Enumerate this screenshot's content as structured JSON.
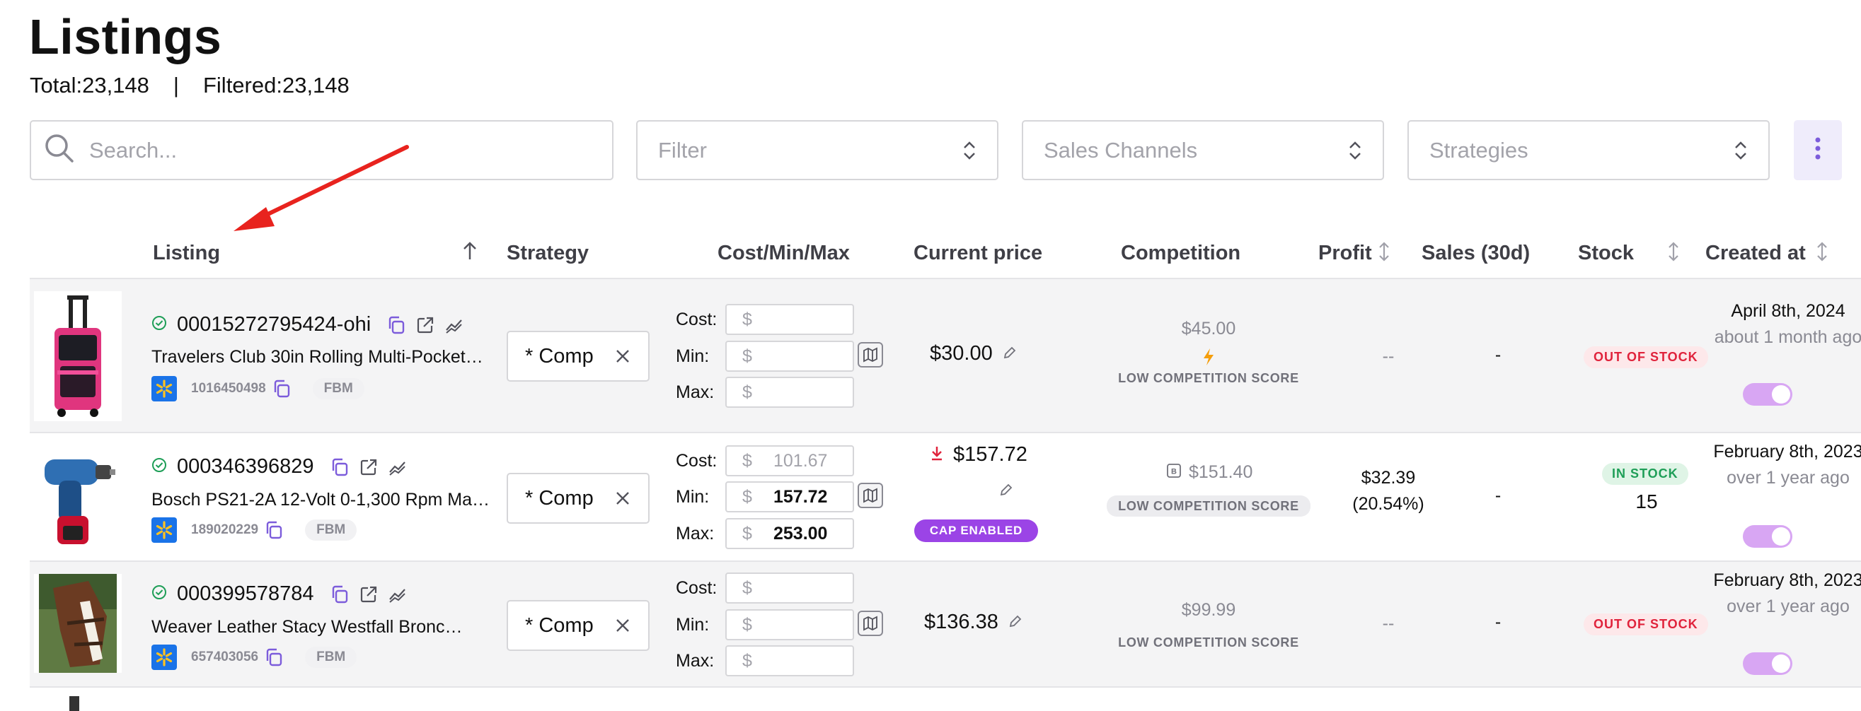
{
  "page": {
    "title": "Listings",
    "total_label": "Total:23,148",
    "separator": "|",
    "filtered_label": "Filtered:23,148"
  },
  "toolbar": {
    "search_placeholder": "Search...",
    "filter_placeholder": "Filter",
    "channels_placeholder": "Sales Channels",
    "strategies_placeholder": "Strategies"
  },
  "table": {
    "headers": {
      "listing": "Listing",
      "strategy": "Strategy",
      "cost_min_max": "Cost/Min/Max",
      "current_price": "Current price",
      "competition": "Competition",
      "profit": "Profit",
      "sales": "Sales (30d)",
      "stock": "Stock",
      "created_at": "Created at"
    },
    "labels": {
      "cost": "Cost:",
      "min": "Min:",
      "max": "Max:",
      "dollar": "$"
    },
    "rows": [
      {
        "sku": "00015272795424-ohi",
        "title": "Travelers Club 30in Rolling Multi-Pocket…",
        "item_id": "1016450498",
        "fulfillment": "FBM",
        "strategy": "* Comp",
        "cost": "",
        "min": "",
        "max": "",
        "current_price": "$30.00",
        "competition_price": "$45.00",
        "competition_score": "LOW COMPETITION SCORE",
        "profit": "--",
        "sales": "-",
        "stock_status": "OUT OF STOCK",
        "stock_qty": "",
        "created_date": "April 8th, 2024",
        "created_relative": "about 1 month ago"
      },
      {
        "sku": "000346396829",
        "title": "Bosch PS21-2A 12-Volt 0-1,300 Rpm Ma…",
        "item_id": "189020229",
        "fulfillment": "FBM",
        "strategy": "* Comp",
        "cost": "101.67",
        "min": "157.72",
        "max": "253.00",
        "current_price": "$157.72",
        "cap_badge": "CAP ENABLED",
        "competition_price": "$151.40",
        "competition_score": "LOW COMPETITION SCORE",
        "profit": "$32.39",
        "profit_pct": "(20.54%)",
        "sales": "-",
        "stock_status": "IN STOCK",
        "stock_qty": "15",
        "created_date": "February 8th, 2023",
        "created_relative": "over 1 year ago"
      },
      {
        "sku": "000399578784",
        "title": "Weaver Leather Stacy Westfall Bronc…",
        "item_id": "657403056",
        "fulfillment": "FBM",
        "strategy": "* Comp",
        "cost": "",
        "min": "",
        "max": "",
        "current_price": "$136.38",
        "competition_price": "$99.99",
        "competition_score": "LOW COMPETITION SCORE",
        "profit": "--",
        "sales": "-",
        "stock_status": "OUT OF STOCK",
        "stock_qty": "",
        "created_date": "February 8th, 2023",
        "created_relative": "over 1 year ago"
      }
    ]
  },
  "colors": {
    "accent": "#7c5cdb",
    "walmart_blue": "#1a73e8",
    "out_of_stock": "#e0233c",
    "in_stock": "#1e9e57",
    "cap_badge": "#9b44e6",
    "toggle_on": "#d8a6f3",
    "annotation_arrow": "#e8231e"
  }
}
